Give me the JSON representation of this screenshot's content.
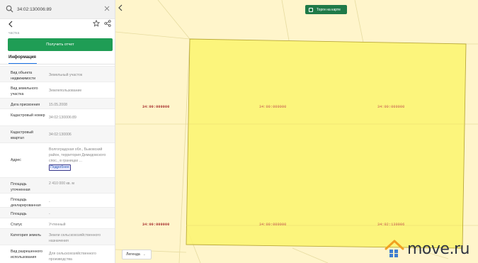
{
  "search": {
    "value": "34:02:130006:89"
  },
  "header": {
    "part_label": "частка",
    "report_button": "Получить отчет"
  },
  "tabs": {
    "info": "Информация"
  },
  "rows": [
    {
      "label": "Вид объекта недвижимости",
      "value": "Земельный участок"
    },
    {
      "label": "Вид земельного участка",
      "value": "Землепользование"
    },
    {
      "label": "Дата присвоения",
      "value": "15.05.2008"
    },
    {
      "label": "Кадастровый номер",
      "value": "34:02:130006:89"
    },
    {
      "label": "Кадастровый квартал",
      "value": "34:02:130006"
    },
    {
      "label": "Адрес",
      "value": "Волгоградская обл., Быковский район, территория Демидовского спос., в границах ...",
      "link": "Подробнее"
    },
    {
      "label": "Площадь уточненная",
      "value": "2 410 000 кв. м"
    },
    {
      "label": "Площадь декларированная",
      "value": "-"
    },
    {
      "label": "Площадь",
      "value": "-"
    },
    {
      "label": "Статус",
      "value": "Учтенный"
    },
    {
      "label": "Категория земель",
      "value": "Земли сельскохозяйственного назначения"
    },
    {
      "label": "Вид разрешенного использования",
      "value": "Для сельскохозяйственного производства"
    }
  ],
  "map": {
    "trade_toggle": "Торги на карте",
    "legend": "Легенда",
    "labels": [
      "34:00:000000",
      "34:00:000000",
      "34:00:000000",
      "34:00:000000",
      "34:00:000000",
      "34:02:130006"
    ],
    "colors": {
      "parcel_fill": "#fbf46e",
      "parcel_border": "#b9a93a",
      "map_bg": "#fff5cb",
      "accent_green": "#1f9d55"
    }
  },
  "watermark": {
    "text": "move.ru"
  }
}
